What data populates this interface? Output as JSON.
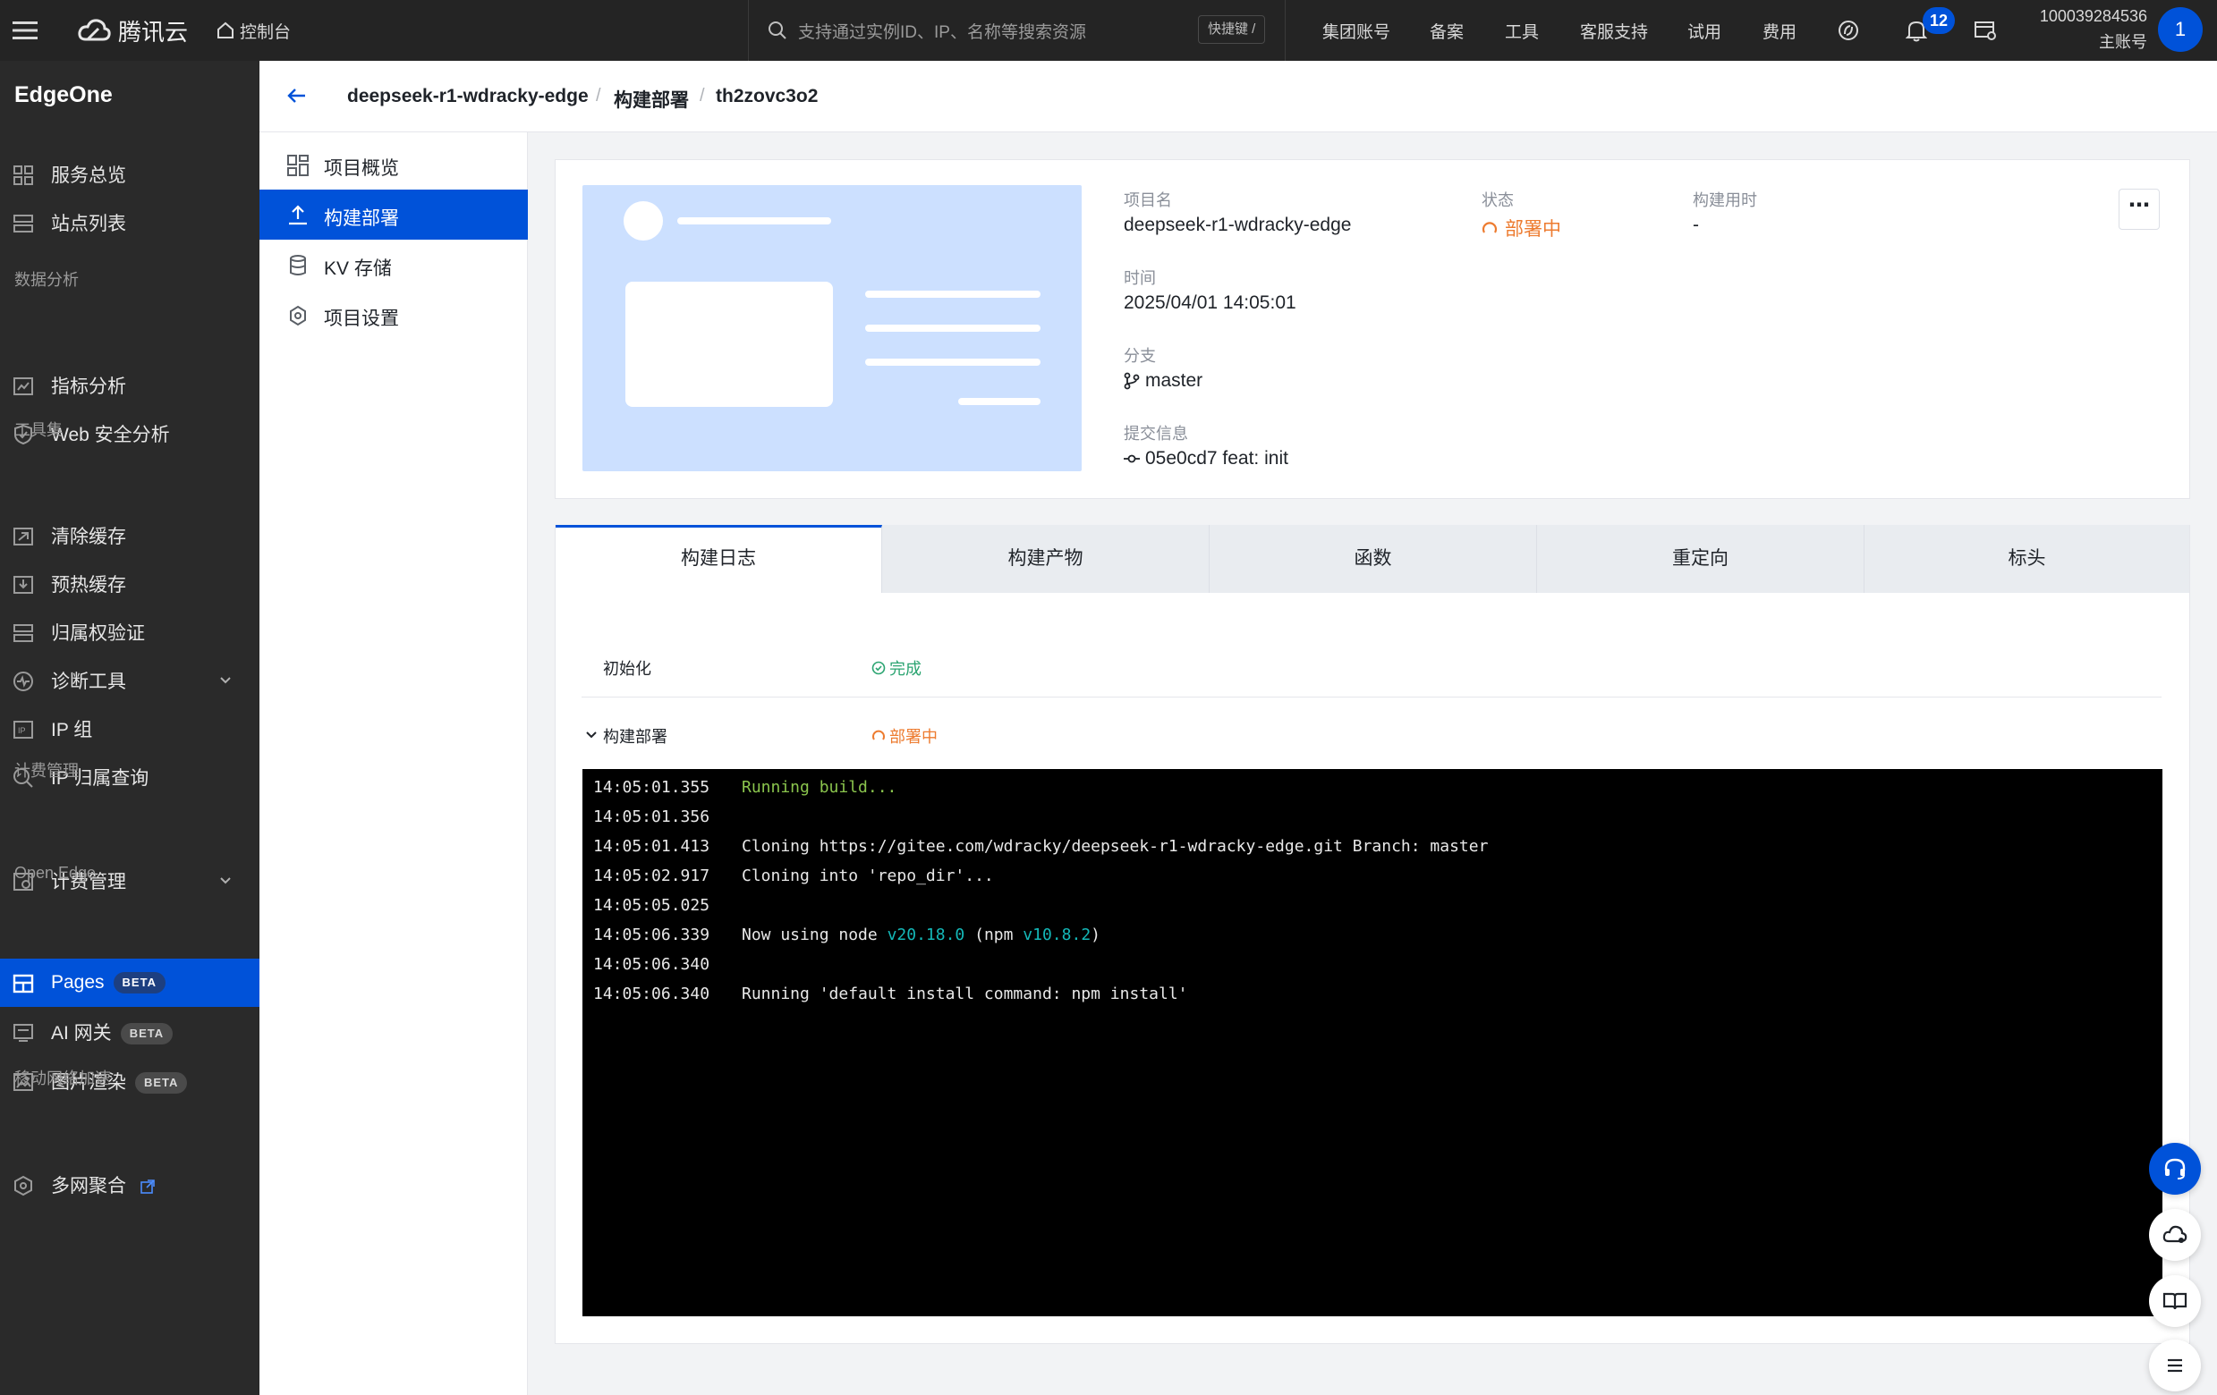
{
  "topbar": {
    "brand": "腾讯云",
    "console": "控制台",
    "search_placeholder": "支持通过实例ID、IP、名称等搜索资源",
    "search_shortcut": "快捷键 /",
    "links": [
      "集团账号",
      "备案",
      "工具",
      "客服支持",
      "试用",
      "费用"
    ],
    "notifications_count": "12",
    "account_id": "100039284536",
    "account_role": "主账号",
    "avatar_initial": "1"
  },
  "sidebar": {
    "brand": "EdgeOne",
    "items": {
      "overview": "服务总览",
      "sites": "站点列表",
      "group_data": "数据分析",
      "metrics": "指标分析",
      "websec": "Web 安全分析",
      "group_tools": "工具集",
      "purge": "清除缓存",
      "prefetch": "预热缓存",
      "ownership": "归属权验证",
      "diagnose": "诊断工具",
      "ipgroup": "IP 组",
      "iplookup": "IP 归属查询",
      "group_billing": "计费管理",
      "billing": "计费管理",
      "group_open": "Open Edge",
      "pages": "Pages",
      "ai_gateway": "AI 网关",
      "image_render": "图片渲染",
      "group_mobile": "移动网络加速",
      "multinet": "多网聚合"
    },
    "beta_label": "BETA"
  },
  "breadcrumb": {
    "project": "deepseek-r1-wdracky-edge",
    "section": "构建部署",
    "deployment": "th2zovc3o2",
    "separator": "/"
  },
  "subnav": {
    "items": [
      "项目概览",
      "构建部署",
      "KV 存储",
      "项目设置"
    ]
  },
  "deployment": {
    "project_label": "项目名",
    "project_value": "deepseek-r1-wdracky-edge",
    "status_label": "状态",
    "status_value": "部署中",
    "build_time_label": "构建用时",
    "build_time_value": "-",
    "time_label": "时间",
    "time_value": "2025/04/01 14:05:01",
    "branch_label": "分支",
    "branch_value": "master",
    "commit_label": "提交信息",
    "commit_value": "05e0cd7 feat: init",
    "more": "⋯"
  },
  "tabs": [
    "构建日志",
    "构建产物",
    "函数",
    "重定向",
    "标头"
  ],
  "steps": {
    "init_label": "初始化",
    "init_status": "完成",
    "deploy_label": "构建部署",
    "deploy_status": "部署中"
  },
  "log": [
    {
      "time": "14:05:01.355",
      "text": "Running build..."
    },
    {
      "time": "14:05:01.356",
      "text": ""
    },
    {
      "time": "14:05:01.413",
      "text": "Cloning https://gitee.com/wdracky/deepseek-r1-wdracky-edge.git Branch: master"
    },
    {
      "time": "14:05:02.917",
      "text": "Cloning into 'repo_dir'..."
    },
    {
      "time": "14:05:05.025",
      "text": ""
    },
    {
      "time": "14:05:06.339",
      "pre": "Now using node ",
      "node": "v20.18.0",
      "mid": " (npm ",
      "npm": "v10.8.2",
      "post": ")"
    },
    {
      "time": "14:05:06.340",
      "text": ""
    },
    {
      "time": "14:05:06.340",
      "text": "Running 'default install command: npm install'"
    }
  ],
  "colors": {
    "accent": "#0052d9",
    "warning": "#ed7b2f",
    "success": "#2ba471",
    "sidebar_bg": "#2a2a2a",
    "topbar_bg": "#242424"
  }
}
